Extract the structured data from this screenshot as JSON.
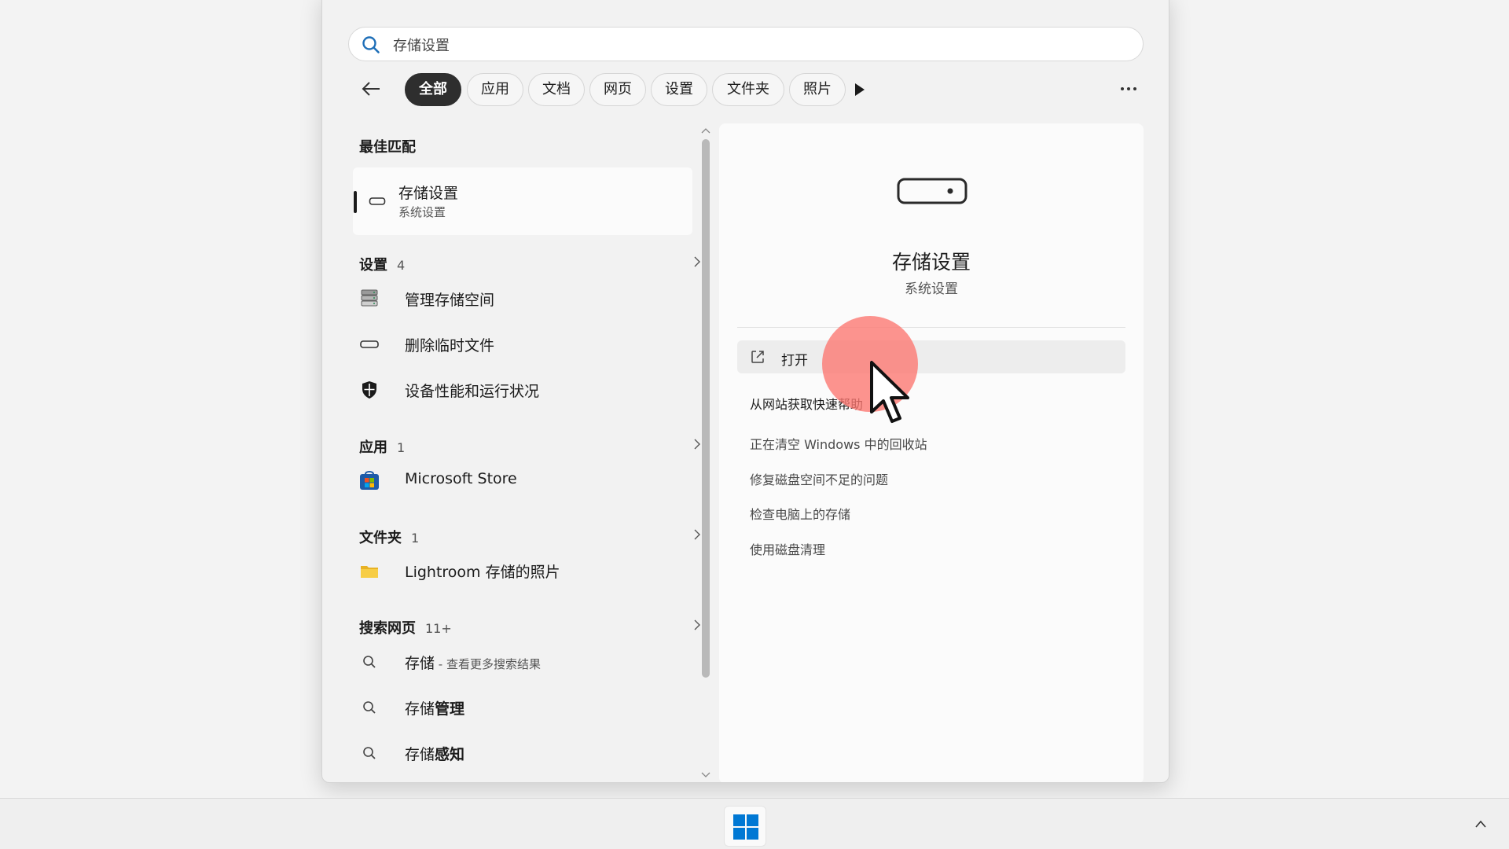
{
  "search": {
    "query": "存储设置"
  },
  "filters": {
    "chips": [
      "全部",
      "应用",
      "文档",
      "网页",
      "设置",
      "文件夹",
      "照片"
    ],
    "active": "全部"
  },
  "best_match": {
    "heading": "最佳匹配",
    "title": "存储设置",
    "subtitle": "系统设置",
    "icon": "storage-drive-icon"
  },
  "sections": {
    "settings": {
      "title": "设置",
      "count": "4",
      "items": [
        {
          "label": "管理存储空间",
          "icon": "storage-stack-icon"
        },
        {
          "label": "删除临时文件",
          "icon": "storage-drive-icon"
        },
        {
          "label": "设备性能和运行状况",
          "icon": "shield-icon"
        }
      ]
    },
    "apps": {
      "title": "应用",
      "count": "1",
      "items": [
        {
          "label": "Microsoft Store",
          "icon": "microsoft-store-icon"
        }
      ]
    },
    "folders": {
      "title": "文件夹",
      "count": "1",
      "items": [
        {
          "label": "Lightroom 存储的照片",
          "icon": "folder-icon"
        }
      ]
    },
    "web": {
      "title": "搜索网页",
      "count": "11+",
      "items": [
        {
          "prefix": "存储",
          "hint": " - 查看更多搜索结果"
        },
        {
          "prefix": "存储",
          "bold": "管理"
        },
        {
          "prefix": "存储",
          "bold": "感知"
        }
      ]
    }
  },
  "preview": {
    "title": "存储设置",
    "subtitle": "系统设置",
    "open_label": "打开",
    "links": [
      "从网站获取快速帮助",
      "正在清空 Windows 中的回收站",
      "修复磁盘空间不足的问题",
      "检查电脑上的存储",
      "使用磁盘清理"
    ]
  }
}
